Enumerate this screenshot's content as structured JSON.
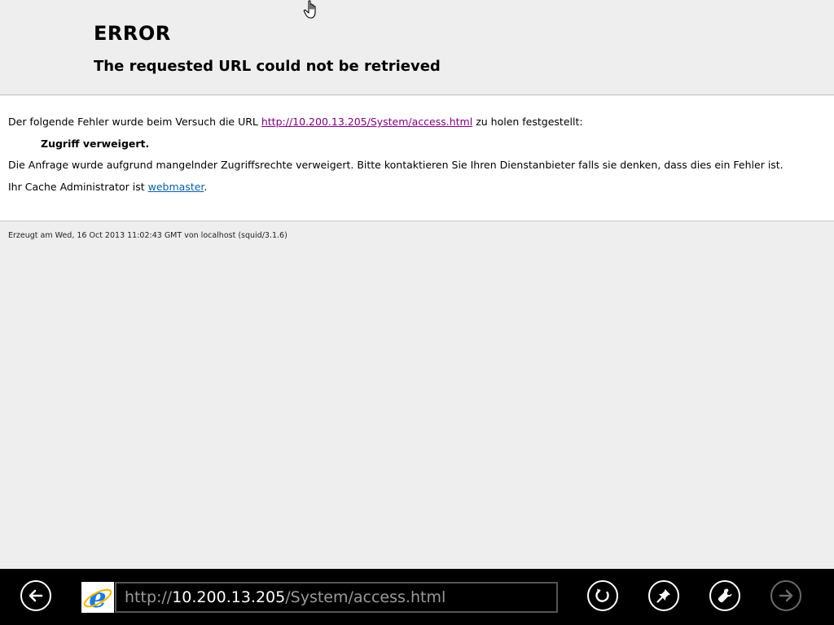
{
  "page": {
    "title": "ERROR",
    "subtitle": "The requested URL could not be retrieved",
    "error_intro_before": "Der folgende Fehler wurde beim Versuch die URL ",
    "error_url": "http://10.200.13.205/System/access.html",
    "error_intro_after": " zu holen festgestellt:",
    "error_reason": "Zugriff verweigert.",
    "error_description": "Die Anfrage wurde aufgrund mangelnder Zugriffsrechte verweigert. Bitte kontaktieren Sie Ihren Dienstanbieter falls sie denken, dass dies ein Fehler ist.",
    "admin_before": "Ihr Cache Administrator ist ",
    "admin_link": "webmaster",
    "admin_after": ".",
    "footer": "Erzeugt am Wed, 16 Oct 2013 11:02:43 GMT von localhost (squid/3.1.6)"
  },
  "appbar": {
    "address_scheme": "http://",
    "address_host": "10.200.13.205",
    "address_path": "/System/access.html",
    "icons": {
      "back": "arrow-left-icon",
      "logo": "internet-explorer-logo",
      "refresh": "refresh-icon",
      "pin": "pin-icon",
      "tools": "wrench-icon",
      "forward": "arrow-right-icon"
    }
  },
  "colors": {
    "page_background": "#eeeeee",
    "content_background": "#ffffff",
    "visited_link": "#800080",
    "link": "#0b5fa5",
    "appbar_background": "#000000"
  }
}
